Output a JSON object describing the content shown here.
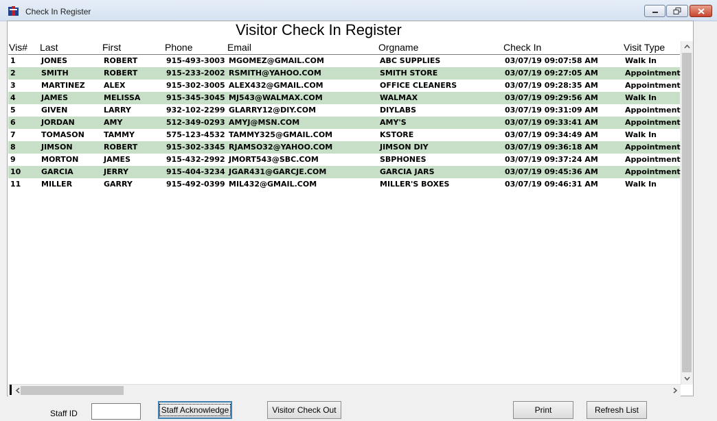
{
  "window": {
    "title": "Check In Register"
  },
  "page": {
    "heading": "Visitor Check In Register"
  },
  "table": {
    "columns": [
      "Vis#",
      "Last",
      "First",
      "Phone",
      "Email",
      "Orgname",
      "Check In",
      "Visit Type"
    ],
    "rows": [
      [
        "1",
        "JONES",
        "ROBERT",
        "915-493-3003",
        "MGOMEZ@GMAIL.COM",
        "ABC SUPPLIES",
        "03/07/19 09:07:58 AM",
        "Walk In"
      ],
      [
        "2",
        "SMITH",
        "ROBERT",
        "915-233-2002",
        "RSMITH@YAHOO.COM",
        "SMITH STORE",
        "03/07/19 09:27:05 AM",
        "Appointment"
      ],
      [
        "3",
        "MARTINEZ",
        "ALEX",
        "915-302-3005",
        "ALEX432@GMAIL.COM",
        "OFFICE CLEANERS",
        "03/07/19 09:28:35 AM",
        "Appointment"
      ],
      [
        "4",
        "JAMES",
        "MELISSA",
        "915-345-3045",
        "MJ543@WALMAX.COM",
        "WALMAX",
        "03/07/19 09:29:56 AM",
        "Walk In"
      ],
      [
        "5",
        "GIVEN",
        "LARRY",
        "932-102-2299",
        "GLARRY12@DIY.COM",
        "DIYLABS",
        "03/07/19 09:31:09 AM",
        "Appointment"
      ],
      [
        "6",
        "JORDAN",
        "AMY",
        "512-349-0293",
        "AMYJ@MSN.COM",
        "AMY'S",
        "03/07/19 09:33:41 AM",
        "Appointment"
      ],
      [
        "7",
        "TOMASON",
        "TAMMY",
        "575-123-4532",
        "TAMMY325@GMAIL.COM",
        "KSTORE",
        "03/07/19 09:34:49 AM",
        "Walk In"
      ],
      [
        "8",
        "JIMSON",
        "ROBERT",
        "915-302-3345",
        "RJAMSO32@YAHOO.COM",
        "JIMSON DIY",
        "03/07/19 09:36:18 AM",
        "Appointment"
      ],
      [
        "9",
        "MORTON",
        "JAMES",
        "915-432-2992",
        "JMORT543@SBC.COM",
        "SBPHONES",
        "03/07/19 09:37:24 AM",
        "Appointment"
      ],
      [
        "10",
        "GARCIA",
        "JERRY",
        "915-404-3234",
        "JGAR431@GARCJE.COM",
        "GARCIA JARS",
        "03/07/19 09:45:36 AM",
        "Appointment"
      ],
      [
        "11",
        "MILLER",
        "GARRY",
        "915-492-0399",
        "MIL432@GMAIL.COM",
        "MILLER'S BOXES",
        "03/07/19 09:46:31 AM",
        "Walk In"
      ]
    ]
  },
  "footer": {
    "staff_id_label": "Staff ID",
    "staff_id_value": "",
    "staff_ack_label": "Staff Acknowledge",
    "checkout_label": "Visitor Check Out",
    "print_label": "Print",
    "refresh_label": "Refresh List"
  },
  "colors": {
    "alt_row": "#c6dfc6",
    "focus_border": "#3c7fb1"
  },
  "icons": [
    "app-icon",
    "minimize-icon",
    "restore-icon",
    "close-icon",
    "scroll-up-icon",
    "scroll-down-icon",
    "scroll-left-icon",
    "scroll-right-icon"
  ]
}
